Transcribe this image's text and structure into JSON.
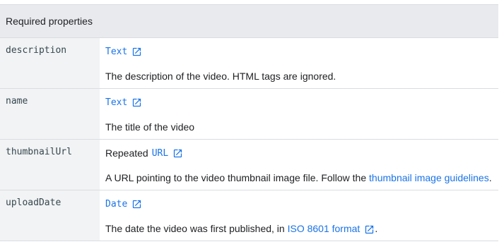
{
  "header": {
    "title": "Required properties"
  },
  "rows": [
    {
      "name": "description",
      "type_label": "Text",
      "text": "The description of the video. HTML tags are ignored."
    },
    {
      "name": "name",
      "type_label": "Text",
      "text": "The title of the video"
    },
    {
      "name": "thumbnailUrl",
      "type_prefix": "Repeated",
      "type_label": "URL",
      "text_before": "A URL pointing to the video thumbnail image file. Follow the ",
      "link_text": "thumbnail image guidelines",
      "text_after": "."
    },
    {
      "name": "uploadDate",
      "type_label": "Date",
      "text_before": "The date the video was first published, in ",
      "link_text": "ISO 8601 format",
      "text_after": "."
    }
  ],
  "colors": {
    "link": "#1a73e8",
    "header_bg": "#e8eaed",
    "property_bg": "#f1f3f4",
    "border": "#dadce0"
  },
  "icons": {
    "external_link": "external-link-icon"
  }
}
